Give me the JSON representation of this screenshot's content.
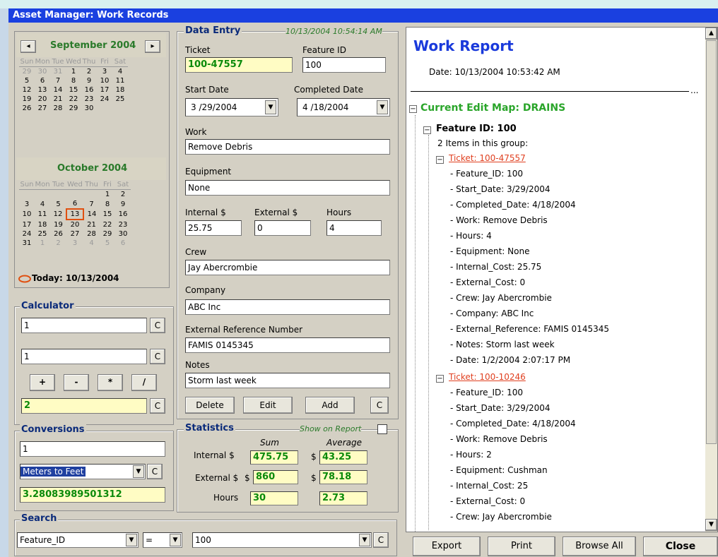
{
  "window": {
    "title": "Asset Manager:  Work Records"
  },
  "calendar": {
    "month1": "September 2004",
    "month2": "October 2004",
    "dow": [
      "Sun",
      "Mon",
      "Tue",
      "Wed",
      "Thu",
      "Fri",
      "Sat"
    ],
    "sep_weeks": [
      [
        "29",
        "30",
        "31",
        "1",
        "2",
        "3",
        "4"
      ],
      [
        "5",
        "6",
        "7",
        "8",
        "9",
        "10",
        "11"
      ],
      [
        "12",
        "13",
        "14",
        "15",
        "16",
        "17",
        "18"
      ],
      [
        "19",
        "20",
        "21",
        "22",
        "23",
        "24",
        "25"
      ],
      [
        "26",
        "27",
        "28",
        "29",
        "30",
        "",
        ""
      ]
    ],
    "oct_weeks": [
      [
        "",
        "",
        "",
        "",
        "",
        "1",
        "2"
      ],
      [
        "3",
        "4",
        "5",
        "6",
        "7",
        "8",
        "9"
      ],
      [
        "10",
        "11",
        "12",
        "13",
        "14",
        "15",
        "16"
      ],
      [
        "17",
        "18",
        "19",
        "20",
        "21",
        "22",
        "23"
      ],
      [
        "24",
        "25",
        "26",
        "27",
        "28",
        "29",
        "30"
      ],
      [
        "31",
        "1",
        "2",
        "3",
        "4",
        "5",
        "6"
      ]
    ],
    "today": "Today: 10/13/2004",
    "prev": "◂",
    "next": "▸"
  },
  "calculator": {
    "legend": "Calculator",
    "field1": "1",
    "field2": "1",
    "result": "2",
    "clear": "C",
    "ops": [
      "+",
      "-",
      "*",
      "/"
    ]
  },
  "conversions": {
    "legend": "Conversions",
    "input": "1",
    "type": "Meters to Feet",
    "result": "3.28083989501312",
    "clear": "C"
  },
  "search": {
    "legend": "Search",
    "field": "Feature_ID",
    "operator": "=",
    "value": "100",
    "clear": "C"
  },
  "data_entry": {
    "legend": "Data Entry",
    "timestamp": "10/13/2004 10:54:14 AM",
    "ticket_label": "Ticket",
    "ticket": "100-47557",
    "feature_label": "Feature ID",
    "feature": "100",
    "start_label": "Start Date",
    "start": "3 /29/2004",
    "completed_label": "Completed Date",
    "completed": "4 /18/2004",
    "work_label": "Work",
    "work": "Remove Debris",
    "equipment_label": "Equipment",
    "equipment": "None",
    "internal_label": "Internal $",
    "internal": "25.75",
    "external_label": "External $",
    "external": "0",
    "hours_label": "Hours",
    "hours": "4",
    "crew_label": "Crew",
    "crew": "Jay Abercrombie",
    "company_label": "Company",
    "company": "ABC Inc",
    "extref_label": "External Reference Number",
    "extref": "FAMIS 0145345",
    "notes_label": "Notes",
    "notes": "Storm last week",
    "delete": "Delete",
    "edit": "Edit",
    "add": "Add",
    "clear": "C"
  },
  "statistics": {
    "legend": "Statistics",
    "show_on_report": "Show on Report",
    "sum_header": "Sum",
    "avg_header": "Average",
    "internal_label": "Internal $",
    "external_label": "External $",
    "hours_label": "Hours",
    "internal_sum": "475.75",
    "internal_avg": "43.25",
    "external_sum": "860",
    "external_avg": "78.18",
    "hours_sum": "30",
    "hours_avg": "2.73",
    "dollar": "$"
  },
  "report": {
    "title": "Work Report",
    "date": "Date:  10/13/2004 10:53:42 AM",
    "ellipsis": "...",
    "edit_map": "Current Edit Map:  DRAINS",
    "feature": "Feature ID: 100",
    "items": "2 Items in this group:",
    "ticket1": "Ticket: 100-47557",
    "ticket1_lines": [
      "- Feature_ID: 100",
      "- Start_Date: 3/29/2004",
      "- Completed_Date: 4/18/2004",
      "- Work: Remove Debris",
      "- Hours: 4",
      "- Equipment: None",
      "- Internal_Cost: 25.75",
      "- External_Cost: 0",
      "- Crew: Jay Abercrombie",
      "- Company: ABC Inc",
      "- External_Reference: FAMIS 0145345",
      "- Notes: Storm last week",
      "- Date: 1/2/2004 2:07:17 PM"
    ],
    "ticket2": "Ticket: 100-10246",
    "ticket2_lines": [
      "- Feature_ID: 100",
      "- Start_Date: 3/29/2004",
      "- Completed_Date: 4/18/2004",
      "- Work: Remove Debris",
      "- Hours: 2",
      "- Equipment: Cushman",
      "- Internal_Cost: 25",
      "- External_Cost: 0",
      "- Crew: Jay Abercrombie"
    ]
  },
  "bottom_buttons": {
    "export": "Export",
    "print": "Print",
    "browse": "Browse All",
    "close": "Close"
  },
  "colors": {
    "title_bar": "#1a40e0",
    "report_title": "#1a3adb",
    "green_text": "#2aa52a",
    "link_red": "#e04020"
  }
}
